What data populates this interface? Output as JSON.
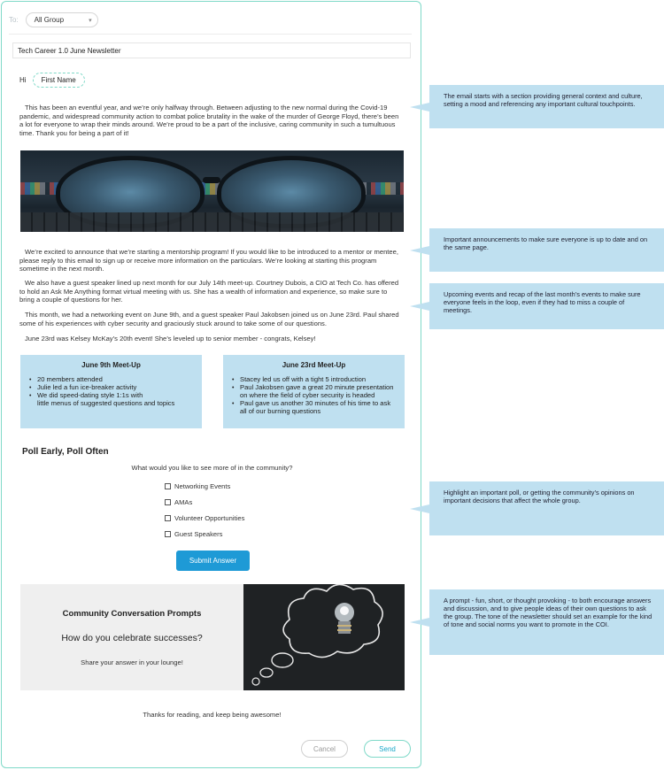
{
  "header": {
    "to_label": "To:",
    "recipient_group": "All Group"
  },
  "subject": "Tech Career 1.0 June Newsletter",
  "greeting": {
    "hi": "Hi",
    "name_token": "First Name"
  },
  "body": {
    "intro": "This has been an eventful year, and we’re only halfway through. Between adjusting to the new normal during the Covid-19 pandemic, and widespread community action to combat police brutality in the wake of the murder of George Floyd, there’s been a lot for everyone to wrap their minds around. We’re proud to be a part of the inclusive, caring community in such a tumultuous time. Thank you for being a part of it!",
    "announcement": "We’re excited to announce that we’re starting a mentorship program! If you would like to be introduced to a mentor or mentee, please reply to this email to sign up or receive more information on the particulars. We’re looking at starting this program sometime in the next month.",
    "speaker": "We also have a guest speaker lined up next month for our July 14th meet-up. Courtney Dubois, a CIO at Tech Co. has offered to hold an Ask Me Anything format virtual meeting with us. She has a wealth of information and experience, so make sure to bring a couple of questions for her.",
    "recap": "This month, we had a networking event on June 9th, and a guest speaker Paul Jakobsen joined us on June 23rd. Paul shared some of his experiences with cyber security and graciously stuck around to take some of our questions.",
    "shoutout": "June 23rd was Kelsey McKay’s 20th event! She’s leveled up to senior member - congrats, Kelsey!"
  },
  "meetups": [
    {
      "title": "June 9th Meet-Up",
      "items": [
        "20 members attended",
        "Julie led a fun ice-breaker activity",
        "We did speed-dating style 1:1s with",
        "little menus of suggested questions and topics"
      ]
    },
    {
      "title": "June 23rd Meet-Up",
      "items": [
        "Stacey led us off with a tight 5 introduction",
        "Paul Jakobsen gave a great 20 minute presentation on where the field of cyber security is headed",
        "Paul gave us another 30 minutes of his time to ask all of our burning questions"
      ]
    }
  ],
  "poll": {
    "title": "Poll Early, Poll Often",
    "question": "What would you like to see more of in the community?",
    "options": [
      "Networking Events",
      "AMAs",
      "Volunteer Opportunities",
      "Guest Speakers"
    ],
    "submit_label": "Submit Answer"
  },
  "prompt": {
    "title": "Community Conversation Prompts",
    "question": "How do you celebrate successes?",
    "sub": "Share your answer in your lounge!"
  },
  "closing": "Thanks for reading, and keep being awesome!",
  "actions": {
    "cancel_label": "Cancel",
    "send_label": "Send"
  },
  "annotations": [
    "The email starts with a section providing general context and culture, setting a mood and referencing any important cultural touchpoints.",
    "Important announcements to make sure everyone is up to date and on the same page.",
    "Upcoming events and recap of the last month’s events to make sure everyone feels in the loop, even if they had to miss a couple of meetings.",
    "Highlight an important poll, or getting the community’s opinions on important decisions that affect the whole group.",
    "A prompt - fun, short, or thought provoking - to both encourage answers and discussion, and to give people ideas of their own questions to ask the group. The tone of the newsletter should set an example for the kind of tone and social norms you want to promote in the COI."
  ],
  "colors": {
    "accent_teal": "#7fd9c8",
    "panel_blue": "#bfe0f0",
    "button_blue": "#1e9ad6"
  }
}
